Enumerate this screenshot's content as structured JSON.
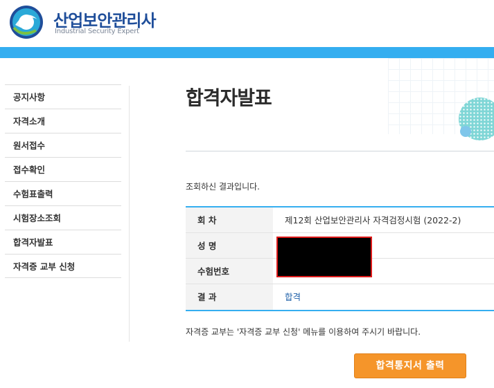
{
  "header": {
    "brand_kr": "산업보안관리사",
    "brand_en": "Industrial Security Expert",
    "logo_icon": "ring-logo-icon"
  },
  "colors": {
    "accent_bar": "#34aef0",
    "button": "#f5952a",
    "brand": "#1f4e9a"
  },
  "sidebar": {
    "items": [
      {
        "label": "공지사항"
      },
      {
        "label": "자격소개"
      },
      {
        "label": "원서접수"
      },
      {
        "label": "접수확인"
      },
      {
        "label": "수험표출력"
      },
      {
        "label": "시험장소조회"
      },
      {
        "label": "합격자발표"
      },
      {
        "label": "자격증 교부 신청"
      }
    ]
  },
  "main": {
    "title": "합격자발표",
    "lookup_message": "조회하신 결과입니다.",
    "table": {
      "rows": [
        {
          "label": "회 차",
          "value": "제12회 산업보안관리사 자격검정시험 (2022-2)"
        },
        {
          "label": "성 명",
          "value": ""
        },
        {
          "label": "수험번호",
          "value": ""
        },
        {
          "label": "결 과",
          "value": "합격"
        }
      ]
    },
    "notice": "자격증 교부는 '자격증 교부 신청' 메뉴를 이용하여 주시기 바랍니다.",
    "print_button": "합격통지서 출력"
  }
}
